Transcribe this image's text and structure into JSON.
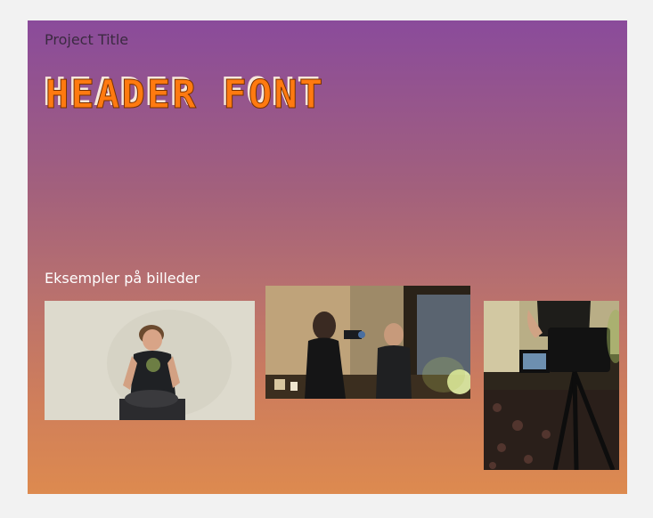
{
  "slide": {
    "project_title": "Project Title",
    "header_font": "HEADER FONT",
    "examples_label": "Eksempler på billeder"
  },
  "colors": {
    "gradient_top": "#8a4b9b",
    "gradient_bottom": "#dd8a4f",
    "header_accent": "#ff7a10",
    "background": "#f2f2f2"
  },
  "images": [
    {
      "subject": "person-sitting-against-wall"
    },
    {
      "subject": "person-filming-with-camera"
    },
    {
      "subject": "camera-on-tripod-filming"
    }
  ]
}
